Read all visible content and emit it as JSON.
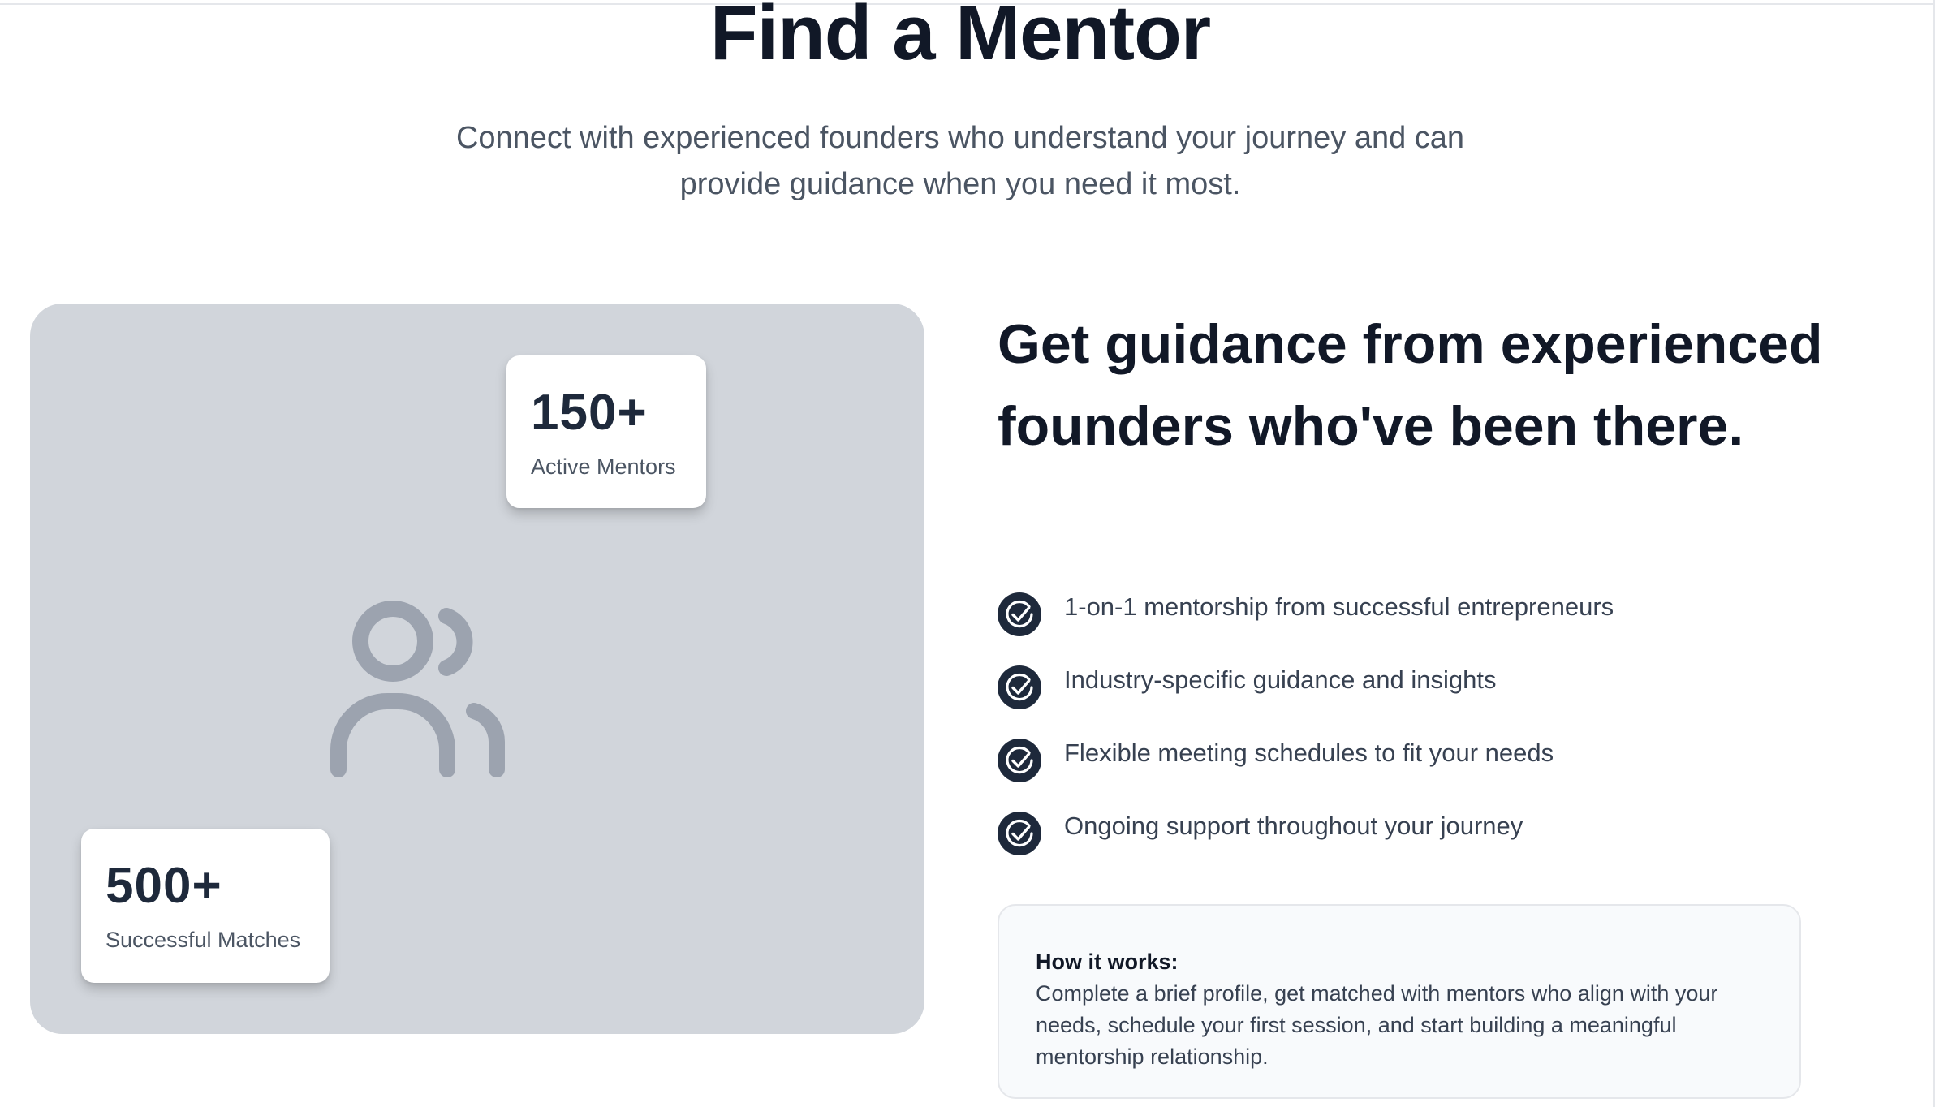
{
  "hero": {
    "title": "Find a Mentor",
    "subtitle": "Connect with experienced founders who understand your journey and can provide guidance when you need it most."
  },
  "stats": [
    {
      "value": "150+",
      "label": "Active Mentors"
    },
    {
      "value": "500+",
      "label": "Successful Matches"
    }
  ],
  "illustration": {
    "icon": "users-icon"
  },
  "section": {
    "heading": "Get guidance from experienced founders who've been there.",
    "features": [
      "1-on-1 mentorship from successful entrepreneurs",
      "Industry-specific guidance and insights",
      "Flexible meeting schedules to fit your needs",
      "Ongoing support throughout your journey"
    ],
    "feature_icon": "check-circle-icon"
  },
  "how_it_works": {
    "title": "How it works:",
    "body": "Complete a brief profile, get matched with mentors who align with your needs, schedule your first session, and start building a meaningful mentorship relationship."
  },
  "colors": {
    "heading": "#111827",
    "body_text": "#4b5563",
    "stat_value": "#1e293b",
    "panel_bg": "#d1d5db",
    "icon_gray": "#9ca3af",
    "check_bg": "#1e293b",
    "box_bg": "#f8fafc"
  }
}
